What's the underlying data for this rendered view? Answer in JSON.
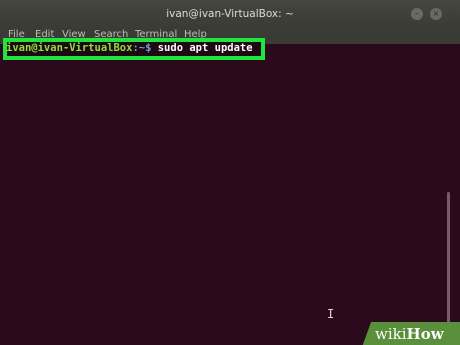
{
  "window": {
    "title": "ivan@ivan-VirtualBox: ~",
    "buttons": {
      "minimize": "–",
      "close": "×"
    }
  },
  "menubar": {
    "items": [
      "File",
      "Edit",
      "View",
      "Search",
      "Terminal",
      "Help"
    ]
  },
  "terminal": {
    "prompt_user": "ivan@ivan-VirtualBox",
    "prompt_path": ":~$",
    "command": "sudo apt update",
    "cursor_glyph": "I",
    "colors": {
      "background": "#2c0a1e",
      "user": "#8ae234",
      "path": "#729fcf",
      "highlight_border": "#1ee63c"
    }
  },
  "watermark": {
    "wiki": "wiki",
    "how": "How",
    "color": "#5a8f3c"
  }
}
